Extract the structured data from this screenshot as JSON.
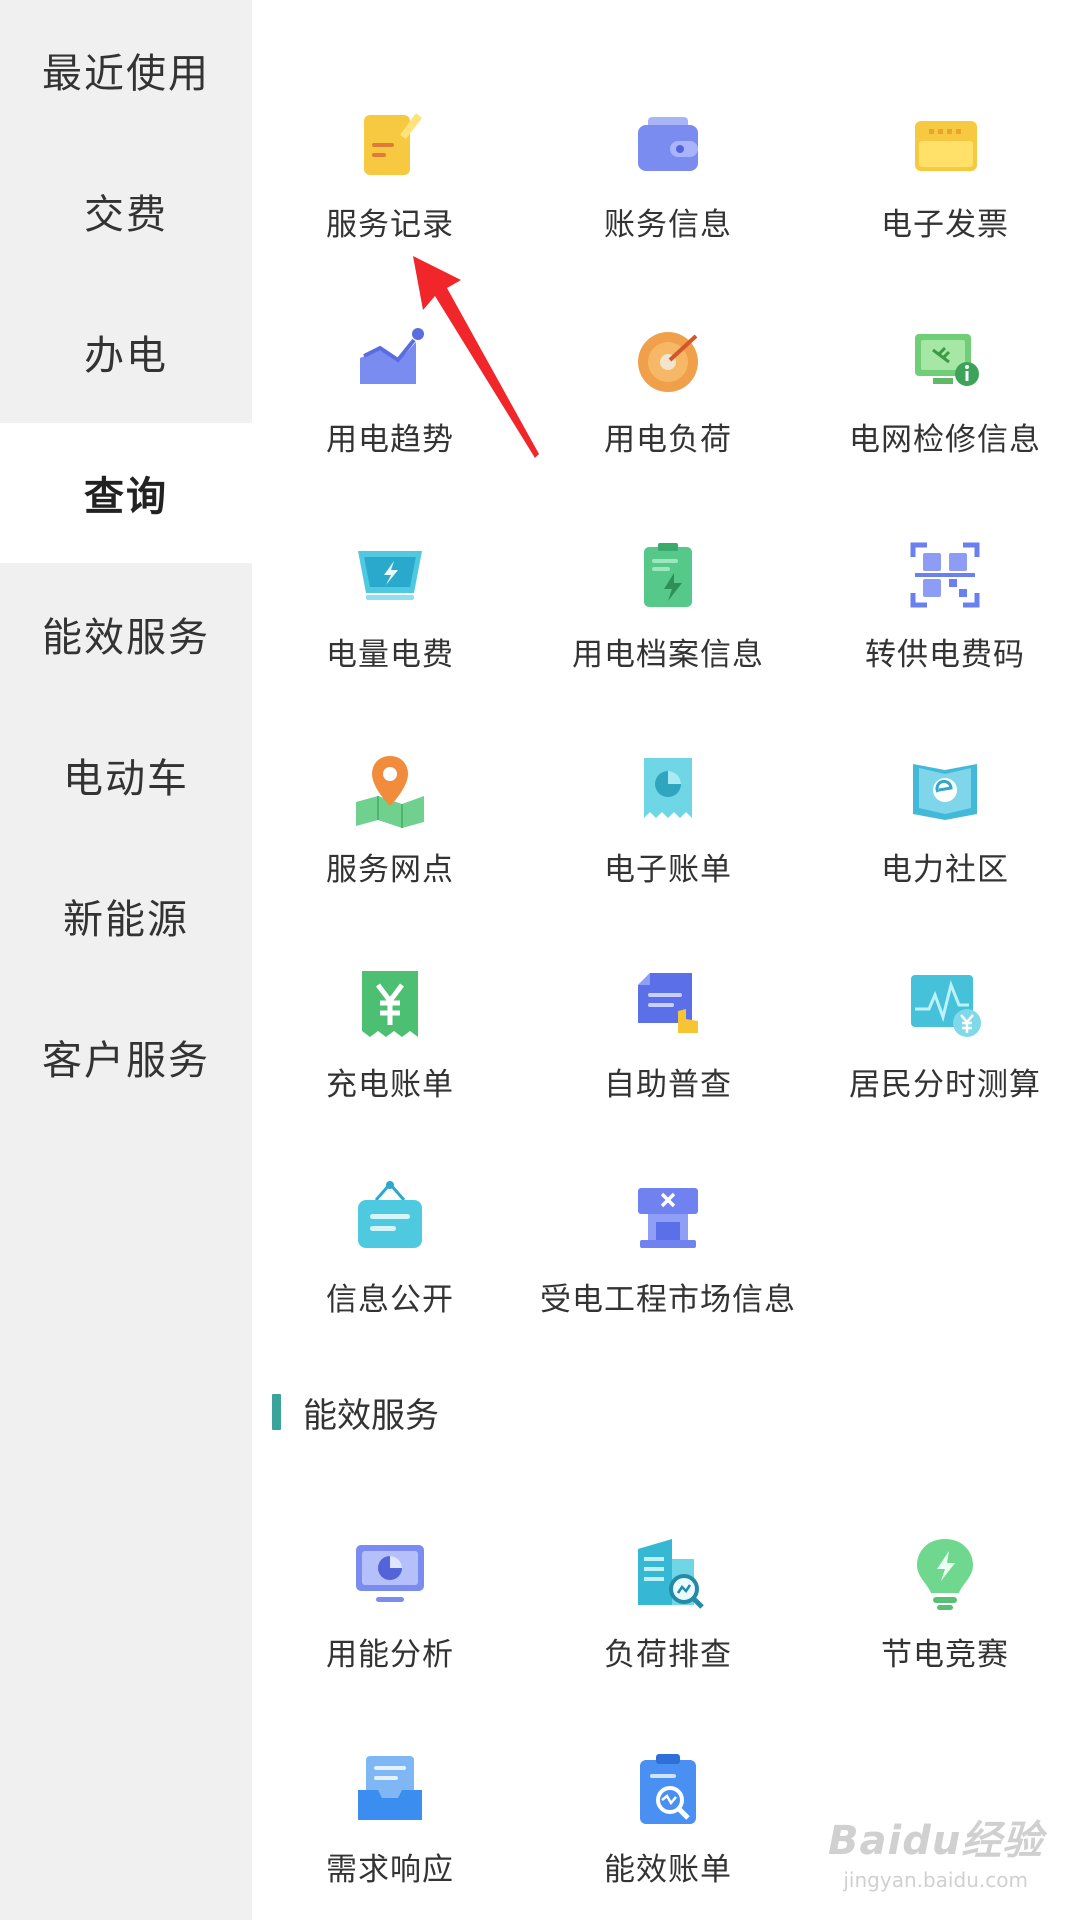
{
  "sidebar": {
    "items": [
      {
        "label": "最近使用"
      },
      {
        "label": "交费"
      },
      {
        "label": "办电"
      },
      {
        "label": "查询"
      },
      {
        "label": "能效服务"
      },
      {
        "label": "电动车"
      },
      {
        "label": "新能源"
      },
      {
        "label": "客户服务"
      }
    ],
    "active": "查询"
  },
  "query_tiles": [
    {
      "label": "服务记录",
      "icon": "service-record-icon"
    },
    {
      "label": "账务信息",
      "icon": "wallet-icon"
    },
    {
      "label": "电子发票",
      "icon": "invoice-icon"
    },
    {
      "label": "用电趋势",
      "icon": "trend-chart-icon"
    },
    {
      "label": "用电负荷",
      "icon": "load-gauge-icon"
    },
    {
      "label": "电网检修信息",
      "icon": "grid-maintenance-icon"
    },
    {
      "label": "电量电费",
      "icon": "electricity-fee-icon"
    },
    {
      "label": "用电档案信息",
      "icon": "archive-file-icon"
    },
    {
      "label": "转供电费码",
      "icon": "qr-code-icon"
    },
    {
      "label": "服务网点",
      "icon": "map-pin-icon"
    },
    {
      "label": "电子账单",
      "icon": "e-bill-icon"
    },
    {
      "label": "电力社区",
      "icon": "community-book-icon"
    },
    {
      "label": "充电账单",
      "icon": "yuan-receipt-icon"
    },
    {
      "label": "自助普查",
      "icon": "self-check-icon"
    },
    {
      "label": "居民分时测算",
      "icon": "time-of-use-icon"
    },
    {
      "label": "信息公开",
      "icon": "notice-board-icon"
    },
    {
      "label": "受电工程市场信息",
      "icon": "construction-market-icon"
    }
  ],
  "energy_section": {
    "title": "能效服务",
    "tiles": [
      {
        "label": "用能分析",
        "icon": "monitor-pie-icon"
      },
      {
        "label": "负荷排查",
        "icon": "building-search-icon"
      },
      {
        "label": "节电竞赛",
        "icon": "bulb-icon"
      },
      {
        "label": "需求响应",
        "icon": "inbox-tray-icon"
      },
      {
        "label": "能效账单",
        "icon": "clipboard-chart-icon"
      }
    ]
  },
  "annotation": {
    "icon": "red-arrow-icon"
  },
  "watermark": {
    "brand": "Baidu经验",
    "url": "jingyan.baidu.com"
  },
  "colors": {
    "sidebar_bg": "#f0f0f0",
    "section_bar": "#3ba49a",
    "arrow": "#f0262b"
  }
}
